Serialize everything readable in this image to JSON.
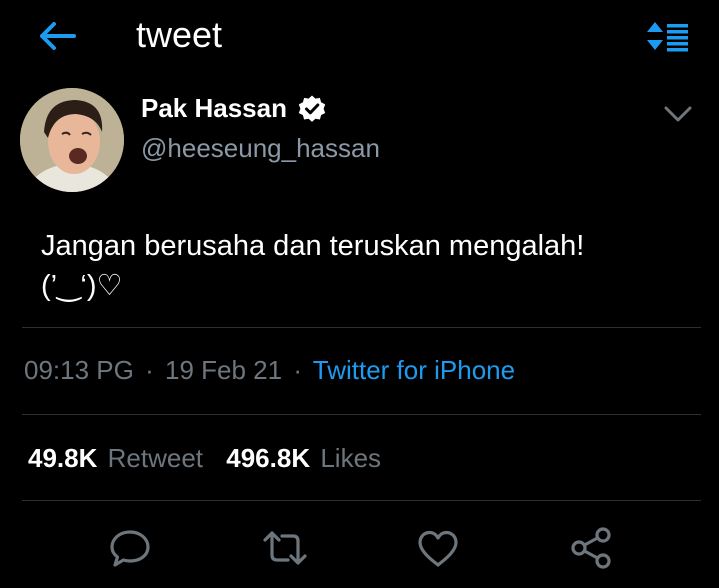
{
  "colors": {
    "background": "#000000",
    "accent": "#1d9bf0",
    "secondary_text": "#6e767d",
    "divider": "#2b3034"
  },
  "header": {
    "title": "tweet",
    "back_icon": "arrow-left-icon",
    "sort_icon": "sort-list-icon"
  },
  "author": {
    "display_name": "Pak Hassan",
    "handle": "@heeseung_hassan",
    "verified": true
  },
  "tweet": {
    "text": "Jangan berusaha dan teruskan mengalah!\n(’‿‘)♡"
  },
  "meta": {
    "time": "09:13 PG",
    "separator": "·",
    "date": "19 Feb 21",
    "source": "Twitter for iPhone"
  },
  "stats": {
    "retweets_count": "49.8K",
    "retweets_label": "Retweet",
    "likes_count": "496.8K",
    "likes_label": "Likes"
  },
  "actions": [
    "reply-icon",
    "retweet-icon",
    "like-icon",
    "share-icon"
  ]
}
